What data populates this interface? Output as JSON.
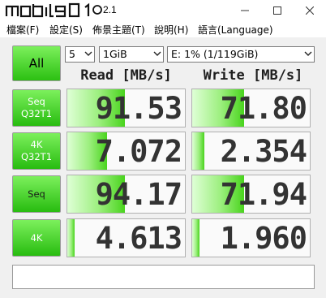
{
  "window": {
    "title": "2.1",
    "logo_text": "mobile01",
    "minimize_icon": "minimize-icon",
    "maximize_icon": "maximize-icon",
    "close_icon": "close-icon"
  },
  "menu": [
    "檔案(F)",
    "設定(S)",
    "佈景主題(T)",
    "說明(H)",
    "語言(Language)"
  ],
  "controls": {
    "all_label": "All",
    "count_value": "5",
    "size_value": "1GiB",
    "drive_value": "E: 1% (1/119GiB)"
  },
  "headers": {
    "read": "Read [MB/s]",
    "write": "Write [MB/s]"
  },
  "tests": [
    {
      "label_line1": "Seq",
      "label_line2": "Q32T1",
      "read": "91.53",
      "write": "71.80",
      "read_fill": 0.49,
      "write_fill": 0.44
    },
    {
      "label_line1": "4K",
      "label_line2": "Q32T1",
      "read": "7.072",
      "write": "2.354",
      "read_fill": 0.34,
      "write_fill": 0.1
    },
    {
      "label_line1": "Seq",
      "label_line2": "",
      "read": "94.17",
      "write": "71.94",
      "read_fill": 0.49,
      "write_fill": 0.44
    },
    {
      "label_line1": "4K",
      "label_line2": "",
      "read": "4.613",
      "write": "1.960",
      "read_fill": 0.06,
      "write_fill": 0.06
    }
  ],
  "status_text": "",
  "colors": {
    "accent_green": "#2cc012",
    "bar_green": "#49d41d",
    "value_text": "#333333"
  }
}
